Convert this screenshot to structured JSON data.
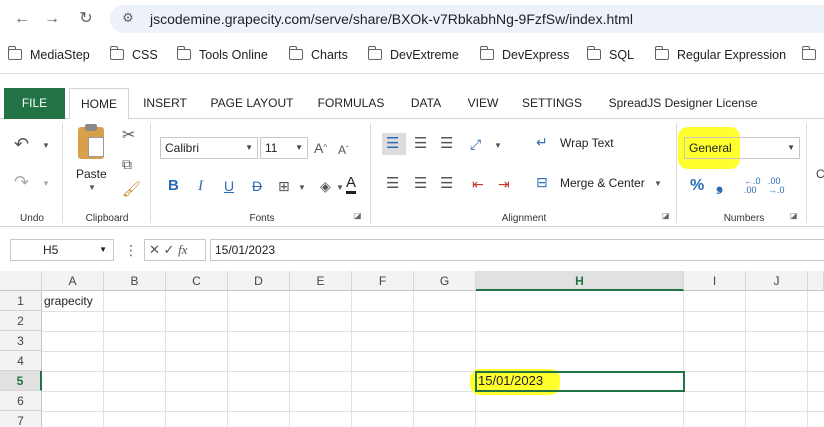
{
  "browser": {
    "url": "jscodemine.grapecity.com/serve/share/BXOk-v7RbkabhNg-9FzfSw/index.html",
    "bookmarks": [
      "MediaStep",
      "CSS",
      "Tools Online",
      "Charts",
      "DevExtreme",
      "DevExpress",
      "SQL",
      "Regular Expression"
    ]
  },
  "ribbon": {
    "tabs": [
      "FILE",
      "HOME",
      "INSERT",
      "PAGE LAYOUT",
      "FORMULAS",
      "DATA",
      "VIEW",
      "SETTINGS",
      "SpreadJS Designer License"
    ],
    "active_tab": "HOME",
    "groups": {
      "undo": "Undo",
      "clipboard": "Clipboard",
      "fonts": "Fonts",
      "alignment": "Alignment",
      "numbers": "Numbers"
    },
    "paste_label": "Paste",
    "font_name": "Calibri",
    "font_size": "11",
    "wrap_text": "Wrap Text",
    "merge_center": "Merge & Center",
    "number_format": "General"
  },
  "formula_bar": {
    "name_box": "H5",
    "fx_label": "fx",
    "formula": "15/01/2023"
  },
  "grid": {
    "columns": [
      "A",
      "B",
      "C",
      "D",
      "E",
      "F",
      "G",
      "H",
      "I",
      "J"
    ],
    "rows": [
      "1",
      "2",
      "3",
      "4",
      "5",
      "6",
      "7"
    ],
    "selected_column": "H",
    "selected_row": "5",
    "cells": {
      "A1": "grapecity",
      "H5": "15/01/2023"
    }
  },
  "colors": {
    "file_tab": "#217346",
    "highlight": "#ffff2e",
    "selection": "#217346"
  }
}
